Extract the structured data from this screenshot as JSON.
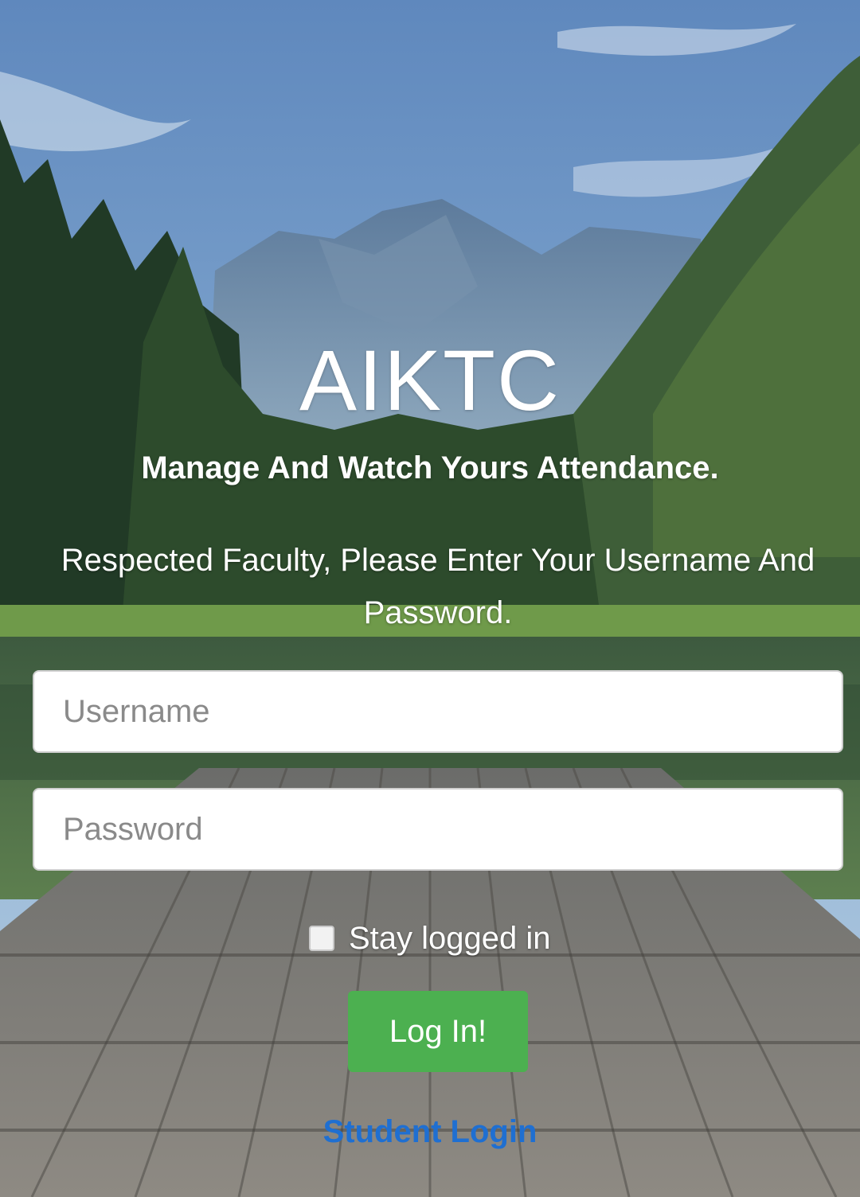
{
  "app": {
    "title": "AIKTC",
    "tagline": "Manage And Watch Yours Attendance.",
    "instruction": "Respected Faculty, Please Enter Your Username And Password."
  },
  "form": {
    "username": {
      "value": "",
      "placeholder": "Username"
    },
    "password": {
      "value": "",
      "placeholder": "Password"
    },
    "stay_logged_in": {
      "label": "Stay logged in",
      "checked": false
    },
    "submit_label": "Log In!"
  },
  "links": {
    "student_login": "Student Login"
  },
  "colors": {
    "button": "#4cb050",
    "link": "#1f6fd1"
  }
}
